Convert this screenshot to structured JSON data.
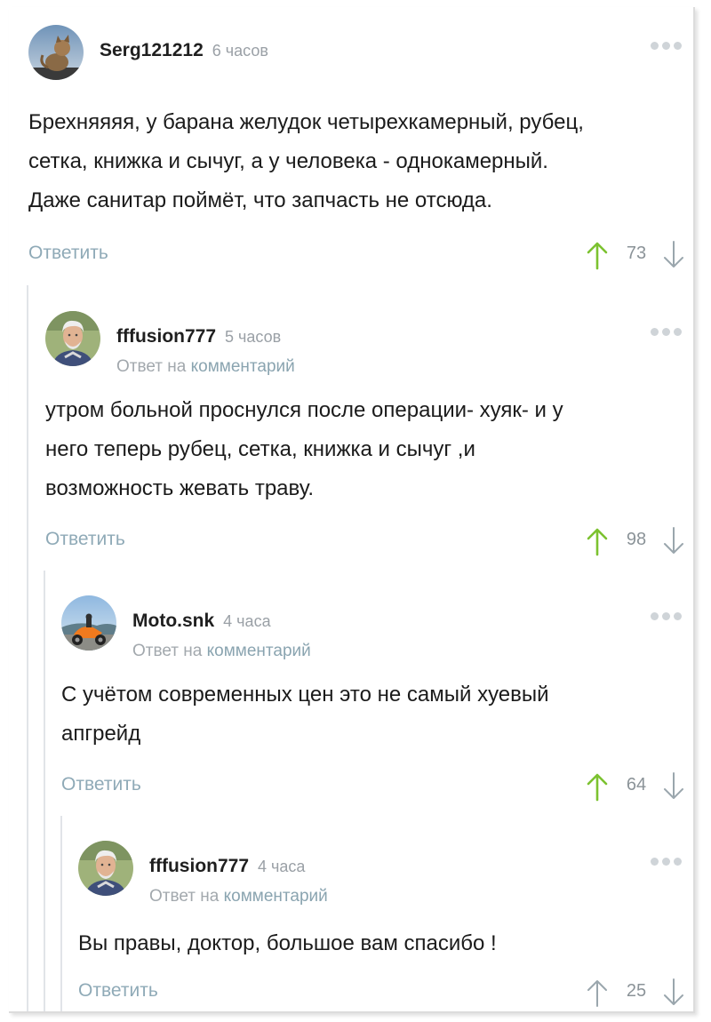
{
  "comments": [
    {
      "author": "Serg121212",
      "time": "6 часов",
      "reply_to": "",
      "reply_link": "",
      "text_lines": [
        "Брехняяяя, у барана желудок четырехкамерный,  рубец,",
        "сетка, книжка и сычуг, а у человека - однокамерный.",
        "Даже санитар поймёт, что запчасть не отсюда."
      ],
      "reply_label": "Ответить",
      "score": "73",
      "upvoted": true,
      "avatar_icon": "cat-avatar-icon"
    },
    {
      "author": "fffusion777",
      "time": "5 часов",
      "reply_to": "Ответ на",
      "reply_link": "комментарий",
      "text_lines": [
        "утром больной проснулся после операции- хуяк- и у",
        "него теперь рубец, сетка, книжка и сычуг ,и",
        "возможность жевать траву."
      ],
      "reply_label": "Ответить",
      "score": "98",
      "upvoted": true,
      "avatar_icon": "old-man-avatar-icon"
    },
    {
      "author": "Moto.snk",
      "time": "4 часа",
      "reply_to": "Ответ на",
      "reply_link": "комментарий",
      "text_lines": [
        "С учётом современных цен это не самый хуевый",
        "апгрейд"
      ],
      "reply_label": "Ответить",
      "score": "64",
      "upvoted": true,
      "avatar_icon": "motorcycle-avatar-icon"
    },
    {
      "author": "fffusion777",
      "time": "4 часа",
      "reply_to": "Ответ на",
      "reply_link": "комментарий",
      "text_lines": [
        "Вы правы, доктор, большое вам спасибо !"
      ],
      "reply_label": "Ответить",
      "score": "25",
      "upvoted": false,
      "avatar_icon": "old-man-avatar-icon"
    }
  ],
  "colors": {
    "upvote_active": "#7cc230",
    "vote_inactive": "#9aa6ad",
    "reply_link": "#8faab7",
    "thread_line": "#e1e4e8"
  }
}
